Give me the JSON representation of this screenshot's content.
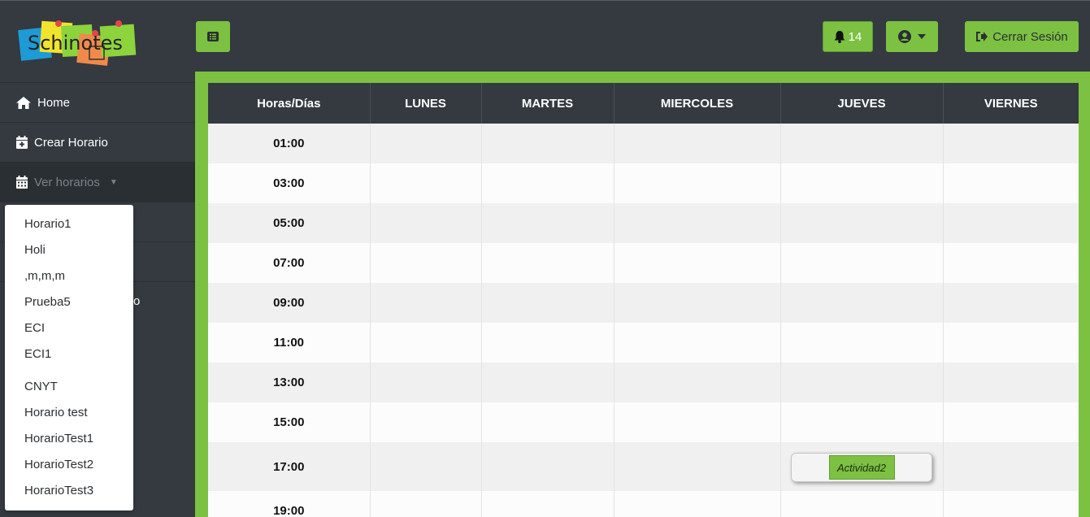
{
  "header": {
    "logo_text": "Schinotes",
    "notifications_count": "14",
    "logout_label": "Cerrar Sesión"
  },
  "sidebar": {
    "items": [
      {
        "label": "Home",
        "icon": "home-icon"
      },
      {
        "label": "Crear Horario",
        "icon": "calendar-plus-icon"
      },
      {
        "label": "Ver horarios",
        "icon": "calendar-icon"
      }
    ],
    "partial_text": "o"
  },
  "dropdown": {
    "items": [
      "Horario1",
      "Holi",
      ",m,m,m",
      "Prueba5",
      "ECI",
      "ECI1",
      "CNYT",
      "Horario test",
      "HorarioTest1",
      "HorarioTest2",
      "HorarioTest3"
    ]
  },
  "schedule": {
    "headers": [
      "Horas/Días",
      "LUNES",
      "MARTES",
      "MIERCOLES",
      "JUEVES",
      "VIERNES"
    ],
    "hours": [
      "01:00",
      "03:00",
      "05:00",
      "07:00",
      "09:00",
      "11:00",
      "13:00",
      "15:00",
      "17:00",
      "19:00"
    ],
    "activity": {
      "label": "Actividad2",
      "day": "JUEVES",
      "hour": "17:00"
    }
  },
  "colors": {
    "accent": "#7cc142",
    "dark": "#343a40"
  }
}
